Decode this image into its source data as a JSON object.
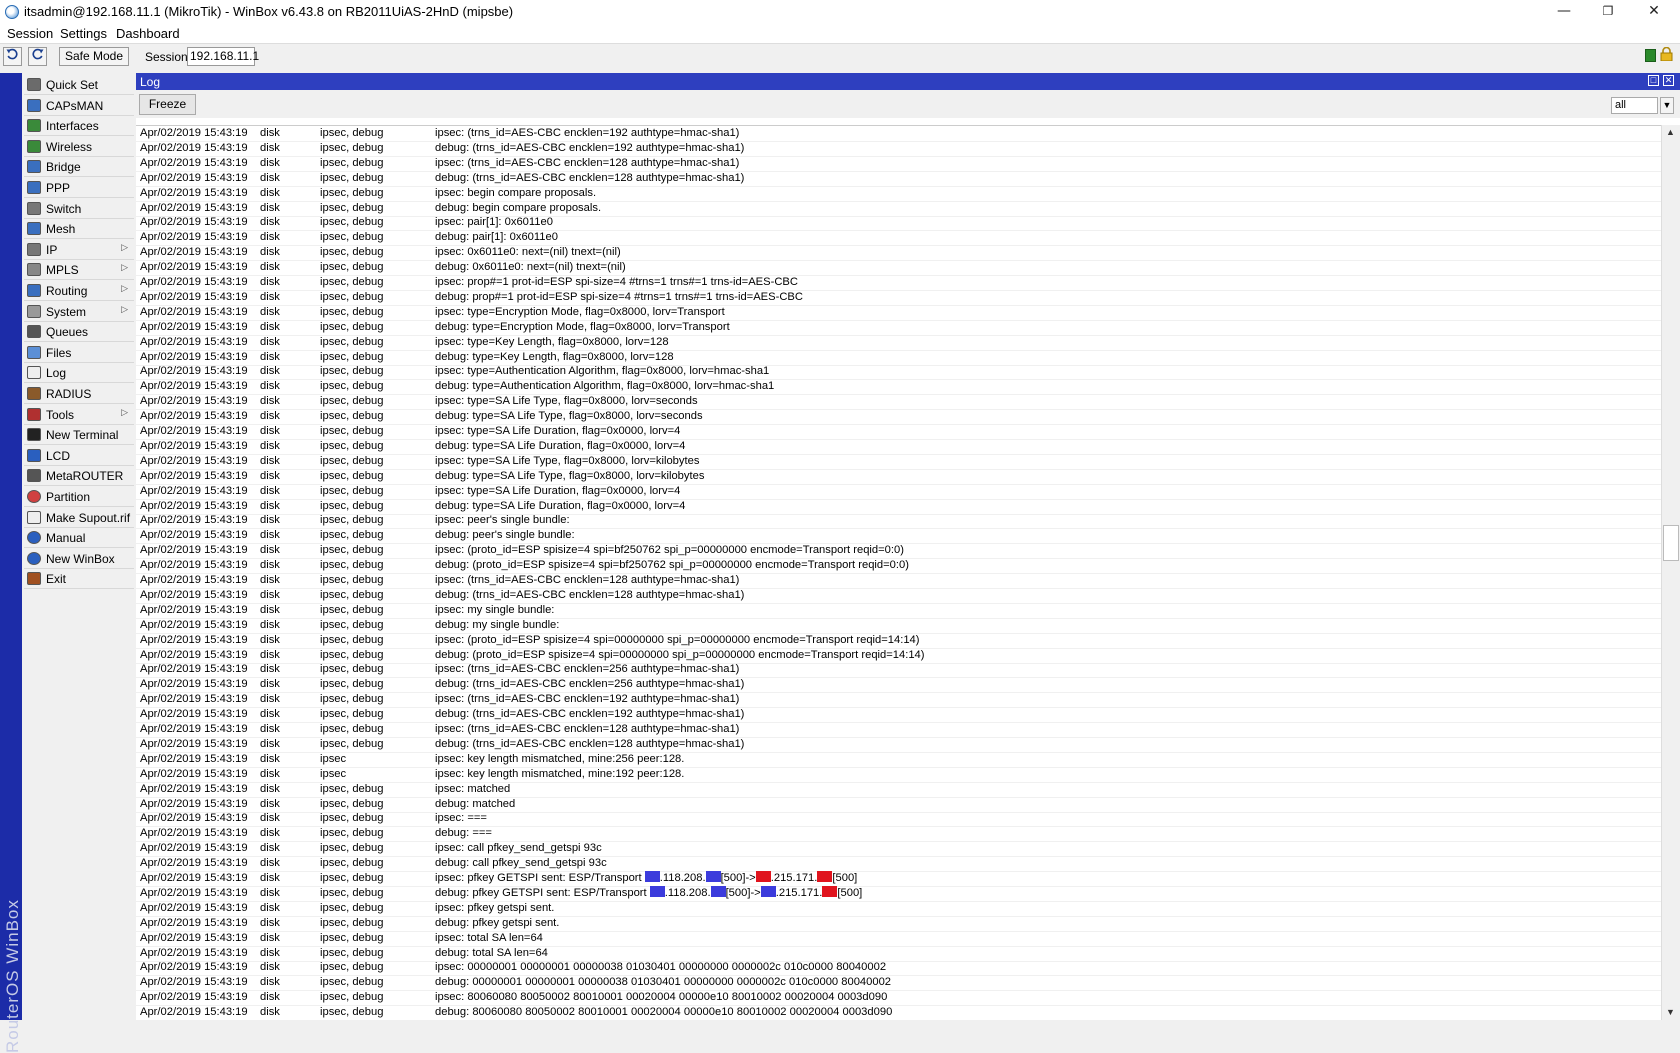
{
  "window": {
    "title": "itsadmin@192.168.11.1 (MikroTik) - WinBox v6.43.8 on RB2011UiAS-2HnD (mipsbe)"
  },
  "menu": [
    "Session",
    "Settings",
    "Dashboard"
  ],
  "toolbar": {
    "safe_mode": "Safe Mode",
    "session_label": "Session:",
    "session_value": "192.168.11.1"
  },
  "brand": "RouterOS WinBox",
  "sidebar": [
    {
      "label": "Quick Set",
      "icon": "quick-set-icon",
      "sub": false
    },
    {
      "label": "CAPsMAN",
      "icon": "capsman-icon",
      "sub": false
    },
    {
      "label": "Interfaces",
      "icon": "interfaces-icon",
      "sub": false
    },
    {
      "label": "Wireless",
      "icon": "wireless-icon",
      "sub": false
    },
    {
      "label": "Bridge",
      "icon": "bridge-icon",
      "sub": false
    },
    {
      "label": "PPP",
      "icon": "ppp-icon",
      "sub": false
    },
    {
      "label": "Switch",
      "icon": "switch-icon",
      "sub": false
    },
    {
      "label": "Mesh",
      "icon": "mesh-icon",
      "sub": false
    },
    {
      "label": "IP",
      "icon": "ip-icon",
      "sub": true
    },
    {
      "label": "MPLS",
      "icon": "mpls-icon",
      "sub": true
    },
    {
      "label": "Routing",
      "icon": "routing-icon",
      "sub": true
    },
    {
      "label": "System",
      "icon": "system-gear-icon",
      "sub": true
    },
    {
      "label": "Queues",
      "icon": "queues-icon",
      "sub": false
    },
    {
      "label": "Files",
      "icon": "folder-icon",
      "sub": false
    },
    {
      "label": "Log",
      "icon": "log-icon",
      "sub": false
    },
    {
      "label": "RADIUS",
      "icon": "radius-icon",
      "sub": false
    },
    {
      "label": "Tools",
      "icon": "tools-icon",
      "sub": true
    },
    {
      "label": "New Terminal",
      "icon": "terminal-icon",
      "sub": false
    },
    {
      "label": "LCD",
      "icon": "lcd-icon",
      "sub": false
    },
    {
      "label": "MetaROUTER",
      "icon": "metarouter-icon",
      "sub": false
    },
    {
      "label": "Partition",
      "icon": "partition-pie-icon",
      "sub": false
    },
    {
      "label": "Make Supout.rif",
      "icon": "document-icon",
      "sub": false
    },
    {
      "label": "Manual",
      "icon": "help-icon",
      "sub": false
    },
    {
      "label": "New WinBox",
      "icon": "winbox-globe-icon",
      "sub": false
    },
    {
      "label": "Exit",
      "icon": "exit-door-icon",
      "sub": false
    }
  ],
  "log": {
    "title": "Log",
    "freeze": "Freeze",
    "filter": "all",
    "rows": [
      [
        "Apr/02/2019 15:43:19",
        "disk",
        "ipsec, debug",
        "ipsec:   (trns_id=AES-CBC encklen=192 authtype=hmac-sha1)"
      ],
      [
        "Apr/02/2019 15:43:19",
        "disk",
        "ipsec, debug",
        "debug:   (trns_id=AES-CBC encklen=192 authtype=hmac-sha1)"
      ],
      [
        "Apr/02/2019 15:43:19",
        "disk",
        "ipsec, debug",
        "ipsec:   (trns_id=AES-CBC encklen=128 authtype=hmac-sha1)"
      ],
      [
        "Apr/02/2019 15:43:19",
        "disk",
        "ipsec, debug",
        "debug:   (trns_id=AES-CBC encklen=128 authtype=hmac-sha1)"
      ],
      [
        "Apr/02/2019 15:43:19",
        "disk",
        "ipsec, debug",
        "ipsec: begin compare proposals."
      ],
      [
        "Apr/02/2019 15:43:19",
        "disk",
        "ipsec, debug",
        "debug: begin compare proposals."
      ],
      [
        "Apr/02/2019 15:43:19",
        "disk",
        "ipsec, debug",
        "ipsec: pair[1]: 0x6011e0"
      ],
      [
        "Apr/02/2019 15:43:19",
        "disk",
        "ipsec, debug",
        "debug: pair[1]: 0x6011e0"
      ],
      [
        "Apr/02/2019 15:43:19",
        "disk",
        "ipsec, debug",
        "ipsec:  0x6011e0: next=(nil) tnext=(nil)"
      ],
      [
        "Apr/02/2019 15:43:19",
        "disk",
        "ipsec, debug",
        "debug:  0x6011e0: next=(nil) tnext=(nil)"
      ],
      [
        "Apr/02/2019 15:43:19",
        "disk",
        "ipsec, debug",
        "ipsec: prop#=1 prot-id=ESP spi-size=4 #trns=1 trns#=1 trns-id=AES-CBC"
      ],
      [
        "Apr/02/2019 15:43:19",
        "disk",
        "ipsec, debug",
        "debug: prop#=1 prot-id=ESP spi-size=4 #trns=1 trns#=1 trns-id=AES-CBC"
      ],
      [
        "Apr/02/2019 15:43:19",
        "disk",
        "ipsec, debug",
        "ipsec: type=Encryption Mode, flag=0x8000, lorv=Transport"
      ],
      [
        "Apr/02/2019 15:43:19",
        "disk",
        "ipsec, debug",
        "debug: type=Encryption Mode, flag=0x8000, lorv=Transport"
      ],
      [
        "Apr/02/2019 15:43:19",
        "disk",
        "ipsec, debug",
        "ipsec: type=Key Length, flag=0x8000, lorv=128"
      ],
      [
        "Apr/02/2019 15:43:19",
        "disk",
        "ipsec, debug",
        "debug: type=Key Length, flag=0x8000, lorv=128"
      ],
      [
        "Apr/02/2019 15:43:19",
        "disk",
        "ipsec, debug",
        "ipsec: type=Authentication Algorithm, flag=0x8000, lorv=hmac-sha1"
      ],
      [
        "Apr/02/2019 15:43:19",
        "disk",
        "ipsec, debug",
        "debug: type=Authentication Algorithm, flag=0x8000, lorv=hmac-sha1"
      ],
      [
        "Apr/02/2019 15:43:19",
        "disk",
        "ipsec, debug",
        "ipsec: type=SA Life Type, flag=0x8000, lorv=seconds"
      ],
      [
        "Apr/02/2019 15:43:19",
        "disk",
        "ipsec, debug",
        "debug: type=SA Life Type, flag=0x8000, lorv=seconds"
      ],
      [
        "Apr/02/2019 15:43:19",
        "disk",
        "ipsec, debug",
        "ipsec: type=SA Life Duration, flag=0x0000, lorv=4"
      ],
      [
        "Apr/02/2019 15:43:19",
        "disk",
        "ipsec, debug",
        "debug: type=SA Life Duration, flag=0x0000, lorv=4"
      ],
      [
        "Apr/02/2019 15:43:19",
        "disk",
        "ipsec, debug",
        "ipsec: type=SA Life Type, flag=0x8000, lorv=kilobytes"
      ],
      [
        "Apr/02/2019 15:43:19",
        "disk",
        "ipsec, debug",
        "debug: type=SA Life Type, flag=0x8000, lorv=kilobytes"
      ],
      [
        "Apr/02/2019 15:43:19",
        "disk",
        "ipsec, debug",
        "ipsec: type=SA Life Duration, flag=0x0000, lorv=4"
      ],
      [
        "Apr/02/2019 15:43:19",
        "disk",
        "ipsec, debug",
        "debug: type=SA Life Duration, flag=0x0000, lorv=4"
      ],
      [
        "Apr/02/2019 15:43:19",
        "disk",
        "ipsec, debug",
        "ipsec: peer's single bundle:"
      ],
      [
        "Apr/02/2019 15:43:19",
        "disk",
        "ipsec, debug",
        "debug: peer's single bundle:"
      ],
      [
        "Apr/02/2019 15:43:19",
        "disk",
        "ipsec, debug",
        "ipsec:  (proto_id=ESP spisize=4 spi=bf250762 spi_p=00000000 encmode=Transport reqid=0:0)"
      ],
      [
        "Apr/02/2019 15:43:19",
        "disk",
        "ipsec, debug",
        "debug:  (proto_id=ESP spisize=4 spi=bf250762 spi_p=00000000 encmode=Transport reqid=0:0)"
      ],
      [
        "Apr/02/2019 15:43:19",
        "disk",
        "ipsec, debug",
        "ipsec:   (trns_id=AES-CBC encklen=128 authtype=hmac-sha1)"
      ],
      [
        "Apr/02/2019 15:43:19",
        "disk",
        "ipsec, debug",
        "debug:   (trns_id=AES-CBC encklen=128 authtype=hmac-sha1)"
      ],
      [
        "Apr/02/2019 15:43:19",
        "disk",
        "ipsec, debug",
        "ipsec: my single bundle:"
      ],
      [
        "Apr/02/2019 15:43:19",
        "disk",
        "ipsec, debug",
        "debug: my single bundle:"
      ],
      [
        "Apr/02/2019 15:43:19",
        "disk",
        "ipsec, debug",
        "ipsec:  (proto_id=ESP spisize=4 spi=00000000 spi_p=00000000 encmode=Transport reqid=14:14)"
      ],
      [
        "Apr/02/2019 15:43:19",
        "disk",
        "ipsec, debug",
        "debug:  (proto_id=ESP spisize=4 spi=00000000 spi_p=00000000 encmode=Transport reqid=14:14)"
      ],
      [
        "Apr/02/2019 15:43:19",
        "disk",
        "ipsec, debug",
        "ipsec:   (trns_id=AES-CBC encklen=256 authtype=hmac-sha1)"
      ],
      [
        "Apr/02/2019 15:43:19",
        "disk",
        "ipsec, debug",
        "debug:   (trns_id=AES-CBC encklen=256 authtype=hmac-sha1)"
      ],
      [
        "Apr/02/2019 15:43:19",
        "disk",
        "ipsec, debug",
        "ipsec:   (trns_id=AES-CBC encklen=192 authtype=hmac-sha1)"
      ],
      [
        "Apr/02/2019 15:43:19",
        "disk",
        "ipsec, debug",
        "debug:   (trns_id=AES-CBC encklen=192 authtype=hmac-sha1)"
      ],
      [
        "Apr/02/2019 15:43:19",
        "disk",
        "ipsec, debug",
        "ipsec:   (trns_id=AES-CBC encklen=128 authtype=hmac-sha1)"
      ],
      [
        "Apr/02/2019 15:43:19",
        "disk",
        "ipsec, debug",
        "debug:   (trns_id=AES-CBC encklen=128 authtype=hmac-sha1)"
      ],
      [
        "Apr/02/2019 15:43:19",
        "disk",
        "ipsec",
        "ipsec: key length mismatched, mine:256 peer:128."
      ],
      [
        "Apr/02/2019 15:43:19",
        "disk",
        "ipsec",
        "ipsec: key length mismatched, mine:192 peer:128."
      ],
      [
        "Apr/02/2019 15:43:19",
        "disk",
        "ipsec, debug",
        "ipsec: matched"
      ],
      [
        "Apr/02/2019 15:43:19",
        "disk",
        "ipsec, debug",
        "debug: matched"
      ],
      [
        "Apr/02/2019 15:43:19",
        "disk",
        "ipsec, debug",
        "ipsec: ==="
      ],
      [
        "Apr/02/2019 15:43:19",
        "disk",
        "ipsec, debug",
        "debug: ==="
      ],
      [
        "Apr/02/2019 15:43:19",
        "disk",
        "ipsec, debug",
        "ipsec: call pfkey_send_getspi 93c"
      ],
      [
        "Apr/02/2019 15:43:19",
        "disk",
        "ipsec, debug",
        "debug: call pfkey_send_getspi 93c"
      ],
      [
        "Apr/02/2019 15:43:19",
        "disk",
        "ipsec, debug",
        "ipsec: pfkey GETSPI sent: ESP/Transport |B|.118.208.|B|[500]->|R|.215.171.|R|[500]"
      ],
      [
        "Apr/02/2019 15:43:19",
        "disk",
        "ipsec, debug",
        "debug: pfkey GETSPI sent: ESP/Transport |B|.118.208.|B|[500]->|B|.215.171.|R|[500]"
      ],
      [
        "Apr/02/2019 15:43:19",
        "disk",
        "ipsec, debug",
        "ipsec: pfkey getspi sent."
      ],
      [
        "Apr/02/2019 15:43:19",
        "disk",
        "ipsec, debug",
        "debug: pfkey getspi sent."
      ],
      [
        "Apr/02/2019 15:43:19",
        "disk",
        "ipsec, debug",
        "ipsec: total SA len=64"
      ],
      [
        "Apr/02/2019 15:43:19",
        "disk",
        "ipsec, debug",
        "debug: total SA len=64"
      ],
      [
        "Apr/02/2019 15:43:19",
        "disk",
        "ipsec, debug",
        "ipsec: 00000001 00000001 00000038 01030401 00000000 0000002c 010c0000 80040002"
      ],
      [
        "Apr/02/2019 15:43:19",
        "disk",
        "ipsec, debug",
        "debug: 00000001 00000001 00000038 01030401 00000000 0000002c 010c0000 80040002"
      ],
      [
        "Apr/02/2019 15:43:19",
        "disk",
        "ipsec, debug",
        "ipsec: 80060080 80050002 80010001 00020004 00000e10 80010002 00020004 0003d090"
      ],
      [
        "Apr/02/2019 15:43:19",
        "disk",
        "ipsec, debug",
        "debug: 80060080 80050002 80010001 00020004 00000e10 80010002 00020004 0003d090"
      ]
    ]
  },
  "colors": {
    "accent": "#2e3fbf",
    "brand_bar": "#1c2ca8",
    "redact_blue": "#3b3bdc",
    "redact_red": "#e0141e"
  }
}
